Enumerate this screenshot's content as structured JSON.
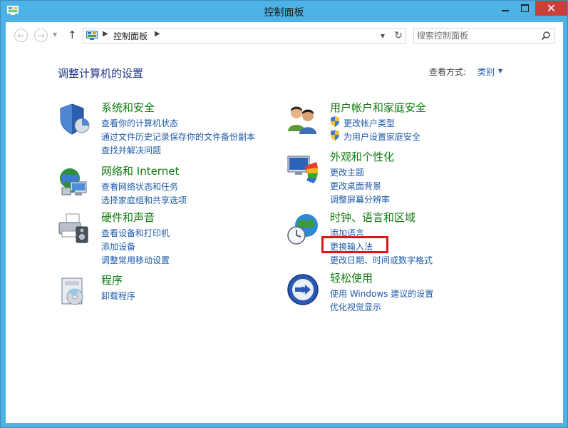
{
  "window": {
    "title": "控制面板",
    "close_label": "✕"
  },
  "navbar": {
    "back_icon": "back-arrow-icon",
    "forward_icon": "forward-arrow-icon",
    "address": {
      "crumb": "控制面板",
      "sep": "▶"
    },
    "search": {
      "placeholder": "搜索控制面板"
    }
  },
  "main": {
    "title": "调整计算机的设置",
    "viewby_label": "查看方式:",
    "viewby_value": "类别"
  },
  "categories": [
    {
      "title": "系统和安全",
      "icon": "shield-icon",
      "links": [
        "查看你的计算机状态",
        "通过文件历史记录保存你的文件备份副本",
        "查找并解决问题"
      ]
    },
    {
      "title": "网络和 Internet",
      "icon": "network-globe-icon",
      "links": [
        "查看网络状态和任务",
        "选择家庭组和共享选项"
      ]
    },
    {
      "title": "硬件和声音",
      "icon": "printer-icon",
      "links": [
        "查看设备和打印机",
        "添加设备",
        "调整常用移动设置"
      ]
    },
    {
      "title": "程序",
      "icon": "programs-icon",
      "links": [
        "卸载程序"
      ]
    },
    {
      "title": "用户帐户和家庭安全",
      "icon": "users-icon",
      "links": [
        "更改帐户类型",
        "为用户设置家庭安全"
      ]
    },
    {
      "title": "外观和个性化",
      "icon": "appearance-icon",
      "links": [
        "更改主题",
        "更改桌面背景",
        "调整屏幕分辨率"
      ]
    },
    {
      "title": "时钟、语言和区域",
      "icon": "clock-globe-icon",
      "links": [
        "添加语言",
        "更换输入法",
        "更改日期、时间或数字格式"
      ]
    },
    {
      "title": "轻松使用",
      "icon": "ease-of-access-icon",
      "links": [
        "使用 Windows 建议的设置",
        "优化视觉显示"
      ]
    }
  ],
  "colors": {
    "frame": "#4db2e6",
    "close": "#c7413a",
    "category_title": "#0f7b0f",
    "link": "#1e5aa8",
    "highlight": "#e0141e"
  }
}
